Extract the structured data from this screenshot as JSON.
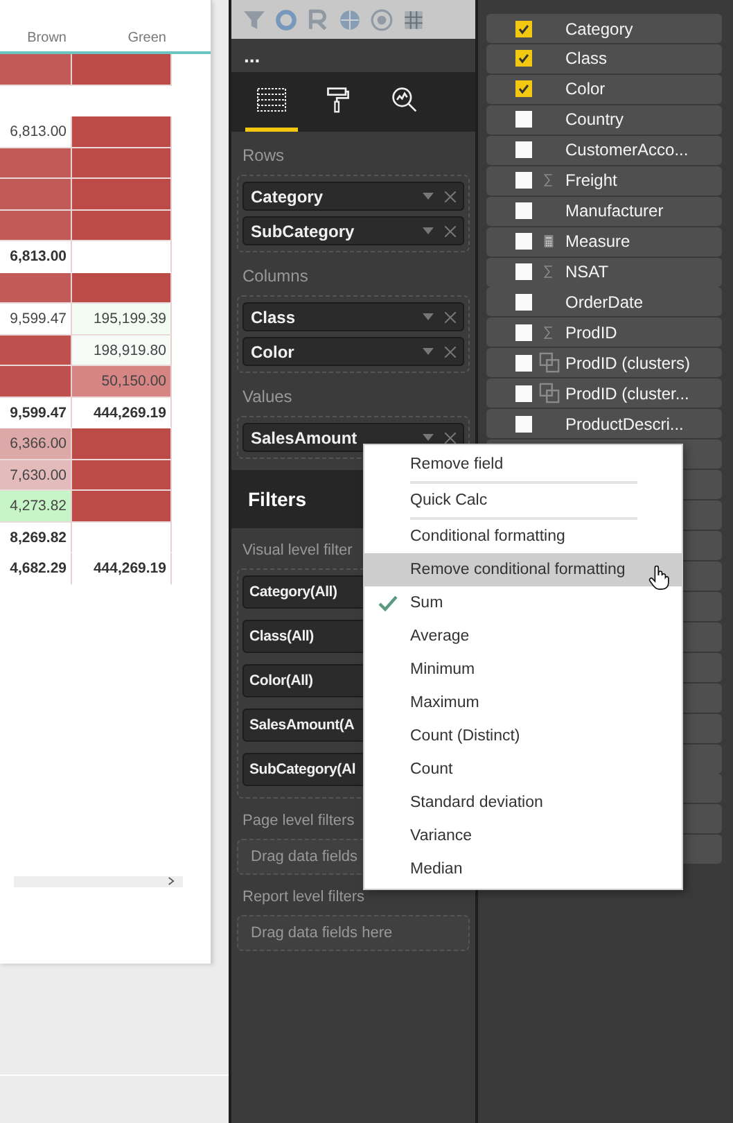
{
  "matrix": {
    "columns": [
      "Brown",
      "Green"
    ],
    "rows": [
      {
        "kind": "data",
        "cells": [
          {
            "text": "",
            "color": "#c25a57"
          },
          {
            "text": "",
            "color": "#bc4a47"
          }
        ]
      },
      {
        "kind": "blank",
        "cells": [
          {
            "text": "",
            "color": "#ffffff"
          },
          {
            "text": "",
            "color": "#ffffff"
          }
        ]
      },
      {
        "kind": "data",
        "cells": [
          {
            "text": "6,813.00",
            "color": "#ffffff"
          },
          {
            "text": "",
            "color": "#bc4a47"
          }
        ]
      },
      {
        "kind": "data",
        "cells": [
          {
            "text": "",
            "color": "#c25a57"
          },
          {
            "text": "",
            "color": "#bc4a47"
          }
        ]
      },
      {
        "kind": "data",
        "cells": [
          {
            "text": "",
            "color": "#c25a57"
          },
          {
            "text": "",
            "color": "#bc4a47"
          }
        ]
      },
      {
        "kind": "data",
        "cells": [
          {
            "text": "",
            "color": "#c25a57"
          },
          {
            "text": "",
            "color": "#bc4a47"
          }
        ]
      },
      {
        "kind": "total",
        "cells": [
          {
            "text": "6,813.00",
            "color": "#ffffff"
          },
          {
            "text": "",
            "color": "#ffffff"
          }
        ]
      },
      {
        "kind": "data",
        "cells": [
          {
            "text": "",
            "color": "#c25a57"
          },
          {
            "text": "",
            "color": "#bc4a47"
          }
        ]
      },
      {
        "kind": "data",
        "cells": [
          {
            "text": "9,599.47",
            "color": "#ffffff"
          },
          {
            "text": "195,199.39",
            "color": "#f3fcf3"
          }
        ]
      },
      {
        "kind": "data",
        "cells": [
          {
            "text": "",
            "color": "#c0504d"
          },
          {
            "text": "198,919.80",
            "color": "#f7fbf7"
          }
        ]
      },
      {
        "kind": "data",
        "cells": [
          {
            "text": "",
            "color": "#c0504d"
          },
          {
            "text": "50,150.00",
            "color": "#d68584"
          }
        ]
      },
      {
        "kind": "total",
        "cells": [
          {
            "text": "9,599.47",
            "color": "#ffffff"
          },
          {
            "text": "444,269.19",
            "color": "#ffffff"
          }
        ]
      },
      {
        "kind": "data",
        "cells": [
          {
            "text": "6,366.00",
            "color": "#dca9a8"
          },
          {
            "text": "",
            "color": "#bc4a47"
          }
        ]
      },
      {
        "kind": "data",
        "cells": [
          {
            "text": "7,630.00",
            "color": "#e2bbba"
          },
          {
            "text": "",
            "color": "#bc4a47"
          }
        ]
      },
      {
        "kind": "data",
        "cells": [
          {
            "text": "4,273.82",
            "color": "#c8f5c8"
          },
          {
            "text": "",
            "color": "#bc4a47"
          }
        ]
      },
      {
        "kind": "total",
        "cells": [
          {
            "text": "8,269.82",
            "color": "#ffffff"
          },
          {
            "text": "",
            "color": "#ffffff"
          }
        ]
      },
      {
        "kind": "total",
        "cells": [
          {
            "text": "4,682.29",
            "color": "#ffffff"
          },
          {
            "text": "444,269.19",
            "color": "#ffffff"
          }
        ]
      }
    ]
  },
  "more_button": "...",
  "pane_tabs": [
    {
      "kind": "fields",
      "selected": true
    },
    {
      "kind": "format",
      "selected": false
    },
    {
      "kind": "analytics",
      "selected": false
    }
  ],
  "wells": [
    {
      "label": "Rows",
      "fields": [
        "Category",
        "SubCategory"
      ]
    },
    {
      "label": "Columns",
      "fields": [
        "Class",
        "Color"
      ]
    },
    {
      "label": "Values",
      "fields": [
        "SalesAmount"
      ]
    }
  ],
  "filters": {
    "title": "Filters",
    "sections": [
      {
        "label": "Visual level filter",
        "chips": [
          "Category(All)",
          "Class(All)",
          "Color(All)",
          "SalesAmount(A",
          "SubCategory(Al"
        ]
      },
      {
        "label": "Page level filters",
        "drop": "Drag data fields"
      },
      {
        "label": "Report level filters",
        "drop": "Drag data fields here"
      }
    ]
  },
  "fields": [
    {
      "label": "Category",
      "checked": true,
      "kind": "plain"
    },
    {
      "label": "Class",
      "checked": true,
      "kind": "plain"
    },
    {
      "label": "Color",
      "checked": true,
      "kind": "plain"
    },
    {
      "label": "Country",
      "checked": false,
      "kind": "plain"
    },
    {
      "label": "CustomerAcco...",
      "checked": false,
      "kind": "plain"
    },
    {
      "label": "Freight",
      "checked": false,
      "kind": "sum"
    },
    {
      "label": "Manufacturer",
      "checked": false,
      "kind": "plain"
    },
    {
      "label": "Measure",
      "checked": false,
      "kind": "calc"
    },
    {
      "label": "NSAT",
      "checked": false,
      "kind": "sum"
    },
    {
      "label": "OrderDate",
      "checked": false,
      "kind": "plain"
    },
    {
      "label": "ProdID",
      "checked": false,
      "kind": "sum"
    },
    {
      "label": "ProdID (clusters)",
      "checked": false,
      "kind": "cluster"
    },
    {
      "label": "ProdID (cluster...",
      "checked": false,
      "kind": "cluster"
    },
    {
      "label": "ProductDescri...",
      "checked": false,
      "kind": "plain"
    }
  ],
  "menu": [
    {
      "label": "Remove field",
      "kind": "action",
      "hovered": false,
      "divider_after": true
    },
    {
      "label": "Quick Calc",
      "kind": "action",
      "hovered": false,
      "divider_after": true
    },
    {
      "label": "Conditional formatting",
      "kind": "action",
      "hovered": false,
      "divider_after": false
    },
    {
      "label": "Remove conditional formatting",
      "kind": "action",
      "hovered": true,
      "divider_after": false
    },
    {
      "label": "Sum",
      "kind": "aggregate",
      "selected": true,
      "hovered": false,
      "divider_after": false
    },
    {
      "label": "Average",
      "kind": "aggregate",
      "selected": false,
      "hovered": false,
      "divider_after": false
    },
    {
      "label": "Minimum",
      "kind": "aggregate",
      "selected": false,
      "hovered": false,
      "divider_after": false
    },
    {
      "label": "Maximum",
      "kind": "aggregate",
      "selected": false,
      "hovered": false,
      "divider_after": false
    },
    {
      "label": "Count (Distinct)",
      "kind": "aggregate",
      "selected": false,
      "hovered": false,
      "divider_after": false
    },
    {
      "label": "Count",
      "kind": "aggregate",
      "selected": false,
      "hovered": false,
      "divider_after": false
    },
    {
      "label": "Standard deviation",
      "kind": "aggregate",
      "selected": false,
      "hovered": false,
      "divider_after": false
    },
    {
      "label": "Variance",
      "kind": "aggregate",
      "selected": false,
      "hovered": false,
      "divider_after": false
    },
    {
      "label": "Median",
      "kind": "aggregate",
      "selected": false,
      "hovered": false,
      "divider_after": false
    }
  ]
}
